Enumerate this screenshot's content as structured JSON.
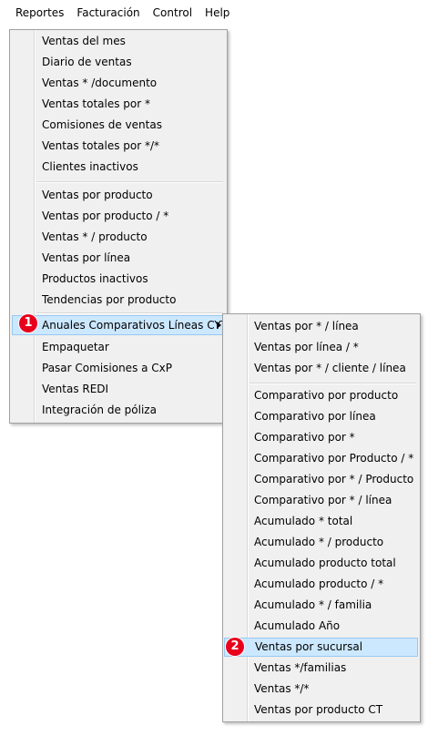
{
  "menubar": [
    "Reportes",
    "Facturación",
    "Control",
    "Help"
  ],
  "main_menu": {
    "group1": [
      "Ventas del mes",
      "Diario de ventas",
      "Ventas * /documento",
      "Ventas totales por *",
      "Comisiones de ventas",
      "Ventas totales por */*",
      "Clientes inactivos"
    ],
    "group2": [
      "Ventas por producto",
      "Ventas por producto / *",
      "Ventas * / producto",
      "Ventas por línea",
      "Productos inactivos",
      "Tendencias por producto"
    ],
    "group3": [
      "Anuales Comparativos Líneas CYT",
      "Empaquetar",
      "Pasar Comisiones a CxP",
      "Ventas REDI",
      "Integración de póliza"
    ]
  },
  "submenu": {
    "group1": [
      "Ventas por * / línea",
      "Ventas por línea / *",
      "Ventas por * / cliente / línea"
    ],
    "group2": [
      "Comparativo por producto",
      "Comparativo por línea",
      "Comparativo por *",
      "Comparativo por Producto / *",
      "Comparativo por * / Producto",
      "Comparativo por * / línea",
      "Acumulado * total",
      "Acumulado * / producto",
      "Acumulado producto total",
      "Acumulado producto / *",
      "Acumulado * / familia",
      "Acumulado Año",
      "Ventas por sucursal",
      "Ventas */familias",
      "Ventas */*",
      "Ventas por producto CT"
    ]
  },
  "badges": [
    "1",
    "2"
  ],
  "colors": {
    "highlight": "#cce8ff",
    "highlight_border": "#99c9ef",
    "badge": "#e8001c",
    "menu_bg": "#f0f0f0"
  }
}
